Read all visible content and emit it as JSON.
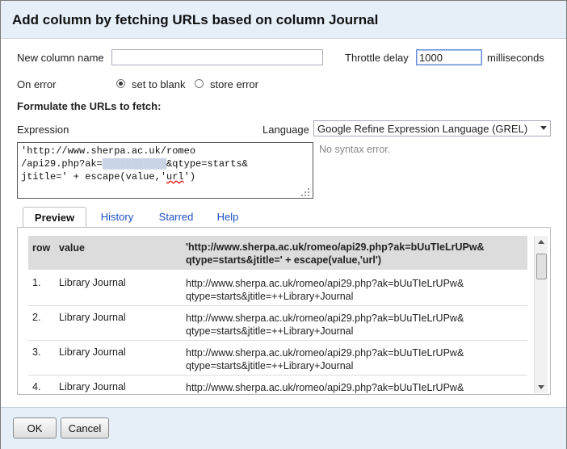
{
  "dialog": {
    "title": "Add column by fetching URLs based on column Journal",
    "new_column_label": "New column name",
    "new_column_value": "",
    "throttle_label": "Throttle delay",
    "throttle_value": "1000",
    "throttle_unit": "milliseconds",
    "on_error_label": "On error",
    "on_error_options": [
      "set to blank",
      "store error"
    ],
    "on_error_selected": "set to blank",
    "formulate_heading": "Formulate the URLs to fetch:",
    "expression_label": "Expression",
    "language_label": "Language",
    "language_value": "Google Refine Expression Language (GREL)",
    "expression_line1": "'http://www.sherpa.ac.uk/romeo",
    "expression_line2_a": "/api29.php?ak=",
    "expression_redacted": "███████████",
    "expression_line2_b": "&qtype=starts&",
    "expression_line3_a": "jtitle=' + escape(value,'",
    "expression_line3_b": "url",
    "expression_line3_c": "')",
    "syntax_status": "No syntax error."
  },
  "tabs": [
    "Preview",
    "History",
    "Starred",
    "Help"
  ],
  "preview": {
    "headers": {
      "row": "row",
      "value": "value",
      "expr_line1": "'http://www.sherpa.ac.uk/romeo/api29.php?ak=bUuTIeLrUPw&",
      "expr_line2": "qtype=starts&jtitle=' + escape(value,'url')"
    },
    "rows": [
      {
        "row": "1.",
        "value": "Library Journal",
        "url1": "http://www.sherpa.ac.uk/romeo/api29.php?ak=bUuTIeLrUPw&",
        "url2": "qtype=starts&jtitle=++Library+Journal"
      },
      {
        "row": "2.",
        "value": "Library Journal",
        "url1": "http://www.sherpa.ac.uk/romeo/api29.php?ak=bUuTIeLrUPw&",
        "url2": "qtype=starts&jtitle=++Library+Journal"
      },
      {
        "row": "3.",
        "value": "Library Journal",
        "url1": "http://www.sherpa.ac.uk/romeo/api29.php?ak=bUuTIeLrUPw&",
        "url2": "qtype=starts&jtitle=++Library+Journal"
      },
      {
        "row": "4.",
        "value": "Library Journal",
        "url1": "http://www.sherpa.ac.uk/romeo/api29.php?ak=bUuTIeLrUPw&",
        "url2": ""
      }
    ]
  },
  "buttons": {
    "ok": "OK",
    "cancel": "Cancel"
  }
}
